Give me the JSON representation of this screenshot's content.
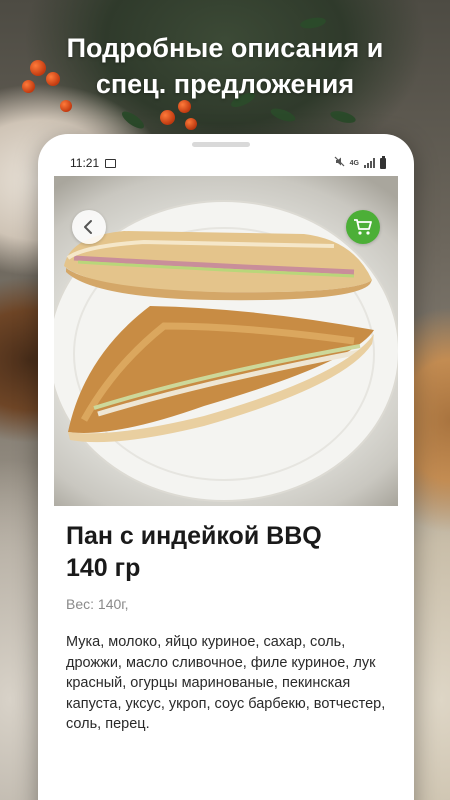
{
  "promo": {
    "headline_line1": "Подробные описания и",
    "headline_line2": "спец. предложения"
  },
  "status_bar": {
    "time": "11:21",
    "network": "4G",
    "icons": [
      "image-icon",
      "mute-icon",
      "signal-icon",
      "battery-icon"
    ]
  },
  "product": {
    "name": "Пан с индейкой BBQ",
    "size": "140 гр",
    "weight": "Вес: 140г,",
    "ingredients": "Мука, молоко, яйцо куриное, сахар, соль, дрожжи, масло сливочное, филе куриное, лук красный, огурцы маринованые, пекинская капуста, уксус, укроп, соус барбекю, вотчестер, соль, перец."
  },
  "actions": {
    "back_icon": "chevron-left-icon",
    "cart_icon": "cart-icon"
  },
  "colors": {
    "accent_green": "#4caf37",
    "text_primary": "#1a1a1a",
    "text_secondary": "#8a8a8a"
  }
}
